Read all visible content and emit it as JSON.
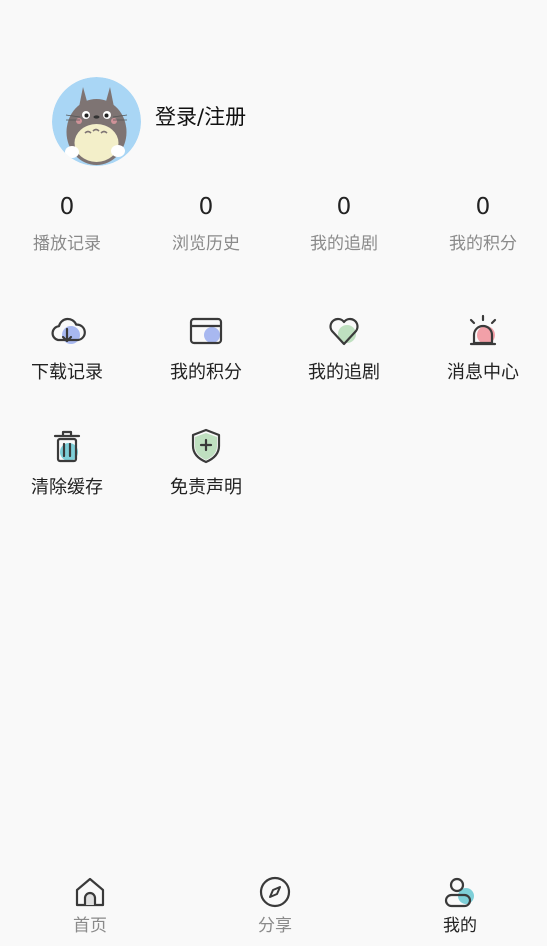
{
  "profile": {
    "login_label": "登录/注册"
  },
  "stats": [
    {
      "value": "0",
      "label": "播放记录"
    },
    {
      "value": "0",
      "label": "浏览历史"
    },
    {
      "value": "0",
      "label": "我的追剧"
    },
    {
      "value": "0",
      "label": "我的积分"
    }
  ],
  "menu": [
    {
      "label": "下载记录",
      "icon": "cloud-download-icon"
    },
    {
      "label": "我的积分",
      "icon": "card-icon"
    },
    {
      "label": "我的追剧",
      "icon": "heart-icon"
    },
    {
      "label": "消息中心",
      "icon": "alarm-bell-icon"
    },
    {
      "label": "清除缓存",
      "icon": "trash-icon"
    },
    {
      "label": "免责声明",
      "icon": "shield-icon"
    }
  ],
  "tabbar": {
    "items": [
      {
        "label": "首页",
        "icon": "home-icon"
      },
      {
        "label": "分享",
        "icon": "compass-icon"
      },
      {
        "label": "我的",
        "icon": "user-icon"
      }
    ],
    "active_index": 2
  },
  "colors": {
    "background": "#f9f9f9",
    "accent_blue": "#a8b8f0",
    "accent_green": "#bfe0c0",
    "accent_red": "#f2a0a8",
    "accent_teal": "#7ecfd8",
    "avatar_bg": "#a9d6f5"
  }
}
